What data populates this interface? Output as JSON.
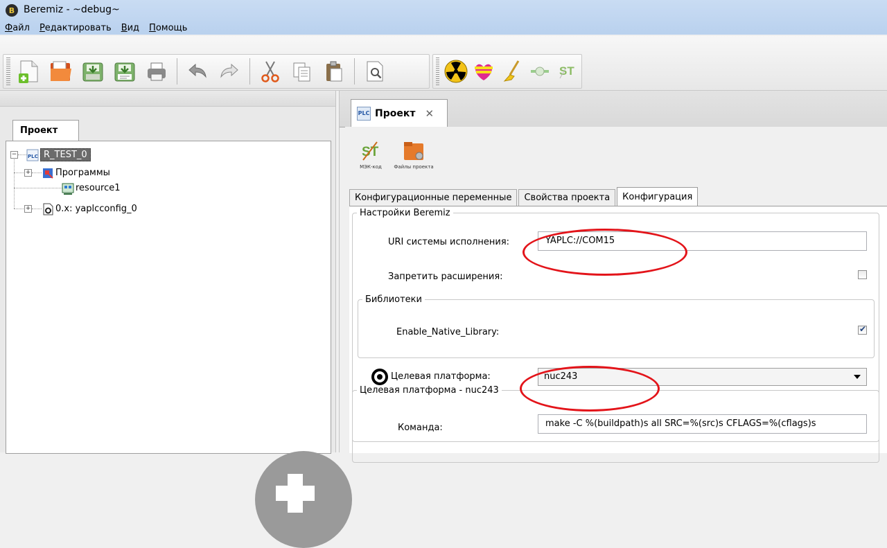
{
  "window": {
    "title": "Beremiz - ~debug~",
    "logo_letter": "B"
  },
  "menu": [
    {
      "label": "Файл",
      "accel": "Ф",
      "rest": "айл"
    },
    {
      "label": "Редактировать",
      "accel": "Р",
      "rest": "едактировать"
    },
    {
      "label": "Вид",
      "accel": "В",
      "rest": "ид"
    },
    {
      "label": "Помощь",
      "accel": "П",
      "rest": "омощь"
    }
  ],
  "toolbar": {
    "icons": [
      "new-file-icon",
      "open-folder-icon",
      "save-icon",
      "save-as-icon",
      "print-icon",
      "undo-icon",
      "redo-icon",
      "cut-icon",
      "copy-icon",
      "paste-icon",
      "find-icon",
      "radiation-icon",
      "build-icon",
      "clean-icon",
      "transfer-icon",
      "st-code-icon"
    ]
  },
  "left_panel": {
    "tab_label": "Проект",
    "tree": [
      {
        "label": "R_TEST_0",
        "icon": "plc-icon",
        "selected": true
      },
      {
        "label": "Программы",
        "icon": "programs-icon"
      },
      {
        "label": "resource1",
        "icon": "resource-icon"
      },
      {
        "label": "0.x: yaplcconfig_0",
        "icon": "config-icon"
      }
    ]
  },
  "right_panel": {
    "doc_tab": {
      "label": "Проект",
      "close": "✕",
      "icon_text": "PLC"
    },
    "buttons": [
      {
        "label": "МЭК-код",
        "icon": "iec-code-icon"
      },
      {
        "label": "Файлы проекта",
        "icon": "project-files-icon"
      }
    ],
    "conf_tabs": [
      "Конфигурационные переменные",
      "Свойства проекта",
      "Конфигурация"
    ],
    "beremiz_settings": {
      "legend": "Настройки Beremiz",
      "uri_label": "URI системы исполнения:",
      "uri_value": "YAPLC://COM15",
      "disable_ext_label": "Запретить расширения:",
      "disable_ext_checked": false
    },
    "libraries": {
      "legend": "Библиотеки",
      "native_label": "Enable_Native_Library:",
      "native_checked": true
    },
    "target": {
      "label": "Целевая платформа:",
      "value": "nuc243"
    },
    "target_section": {
      "legend": "Целевая платформа - nuc243",
      "command_label": "Команда:",
      "command_value": "make -C %(buildpath)s all SRC=%(src)s CFLAGS=%(cflags)s"
    }
  },
  "colors": {
    "highlight_ellipse": "#e3141a",
    "titlebar": "#c9dcf3"
  }
}
